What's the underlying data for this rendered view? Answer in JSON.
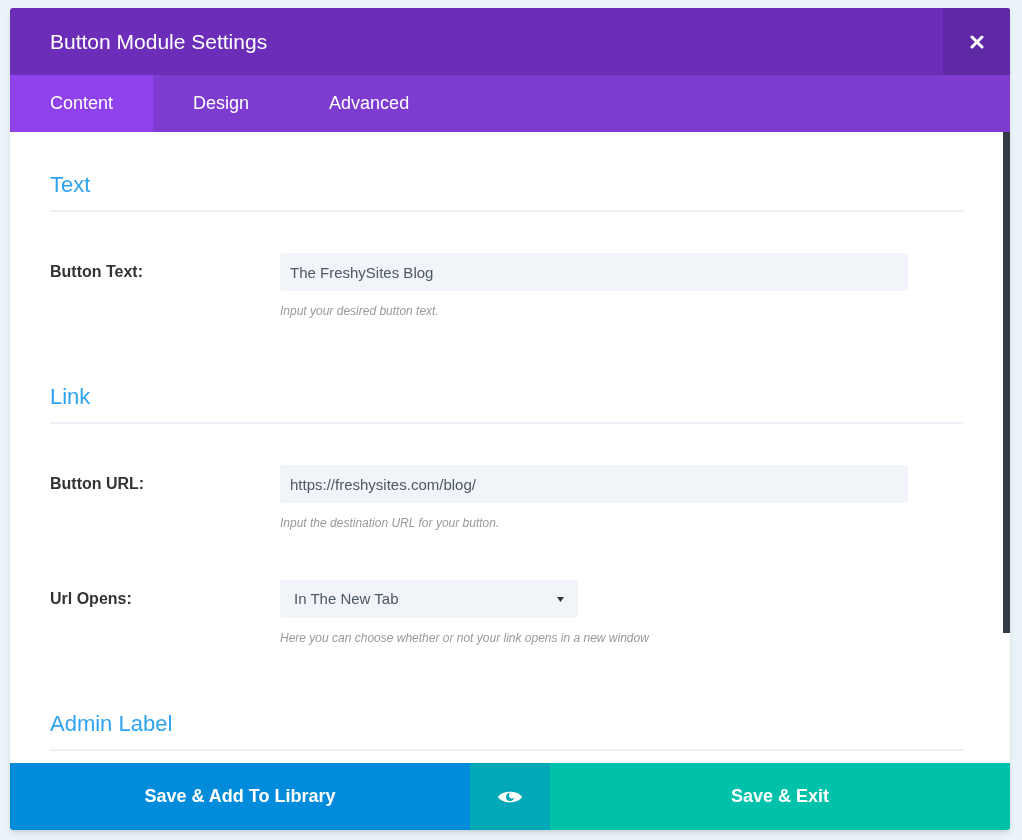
{
  "window": {
    "title": "Button Module Settings"
  },
  "tabs": [
    {
      "label": "Content",
      "selected": true
    },
    {
      "label": "Design",
      "selected": false
    },
    {
      "label": "Advanced",
      "selected": false
    }
  ],
  "sections": [
    {
      "title": "Text",
      "fields": [
        {
          "kind": "text",
          "label": "Button Text:",
          "value": "The FreshySites Blog",
          "help": "Input your desired button text."
        }
      ]
    },
    {
      "title": "Link",
      "fields": [
        {
          "kind": "text",
          "label": "Button URL:",
          "value": "https://freshysites.com/blog/",
          "help": "Input the destination URL for your button."
        },
        {
          "kind": "select",
          "label": "Url Opens:",
          "value": "In The New Tab",
          "help": "Here you can choose whether or not your link opens in a new window"
        }
      ]
    },
    {
      "title": "Admin Label"
    }
  ],
  "footer": {
    "library_button": "Save & Add To Library",
    "exit_button": "Save & Exit"
  }
}
